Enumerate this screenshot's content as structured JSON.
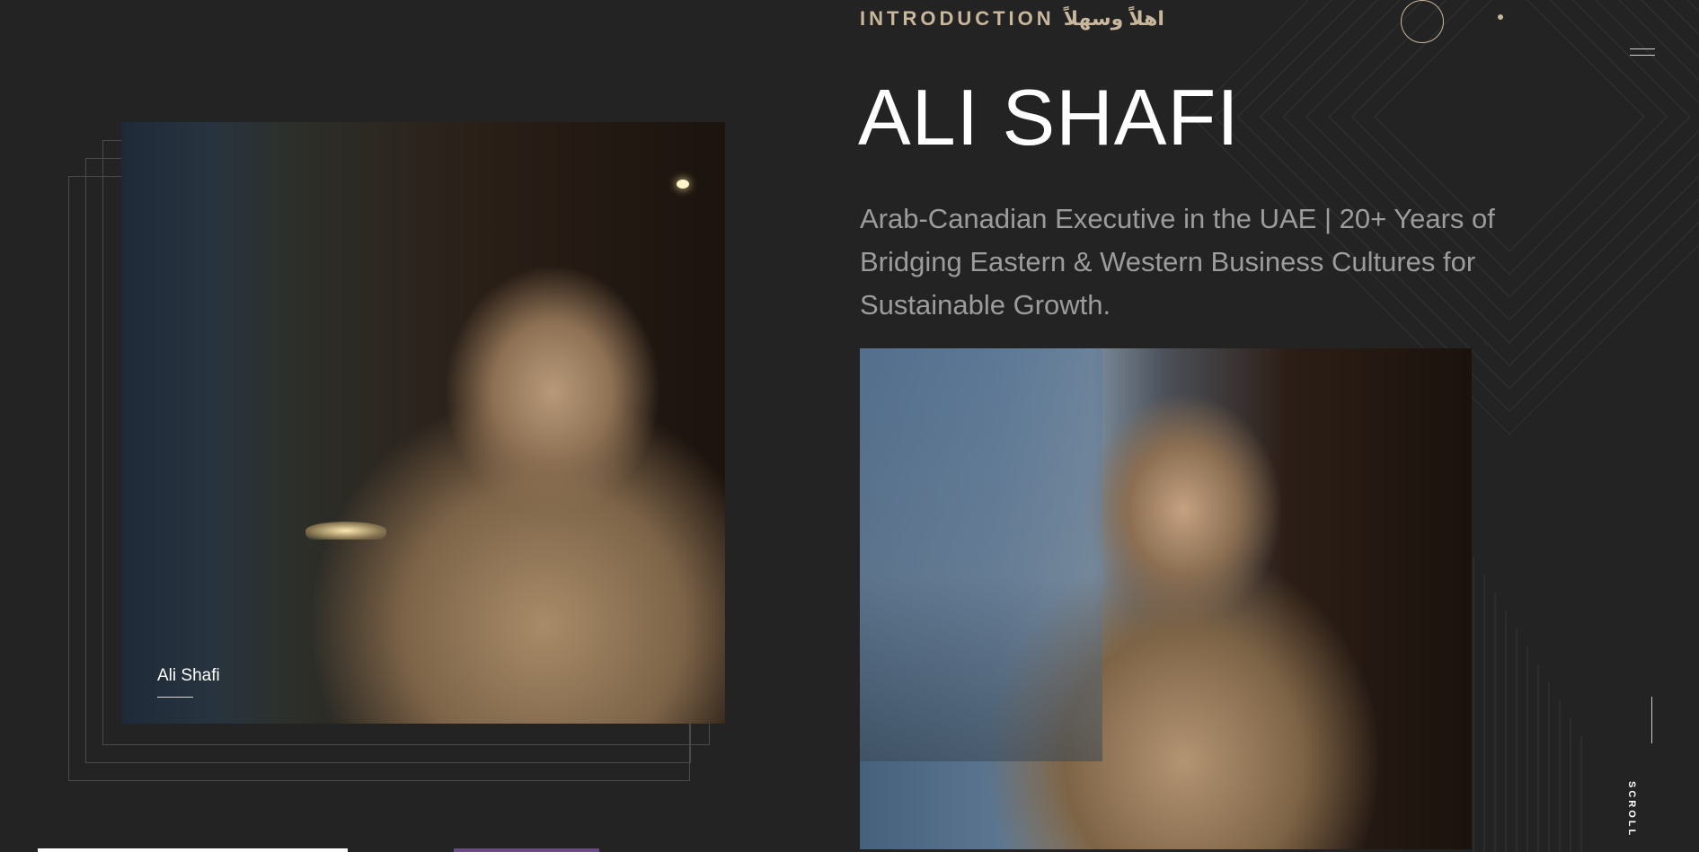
{
  "header": {
    "intro_label": "INTRODUCTION اهلاً وسهلاً"
  },
  "hero": {
    "title": "ALI SHAFI",
    "subtitle": "Arab-Canadian Executive in the UAE | 20+ Years of Bridging Eastern & Western Business Cultures for Sustainable Growth."
  },
  "gallery": {
    "left_caption": "Ali Shafi"
  },
  "controls": {
    "scroll_label": "SCROLL"
  },
  "colors": {
    "background": "#232323",
    "accent": "#c9b79c",
    "heading": "#ffffff",
    "subtitle": "#9c9c9c"
  },
  "icons": [
    "circle-outline-icon",
    "dot-icon",
    "hamburger-menu-icon"
  ]
}
